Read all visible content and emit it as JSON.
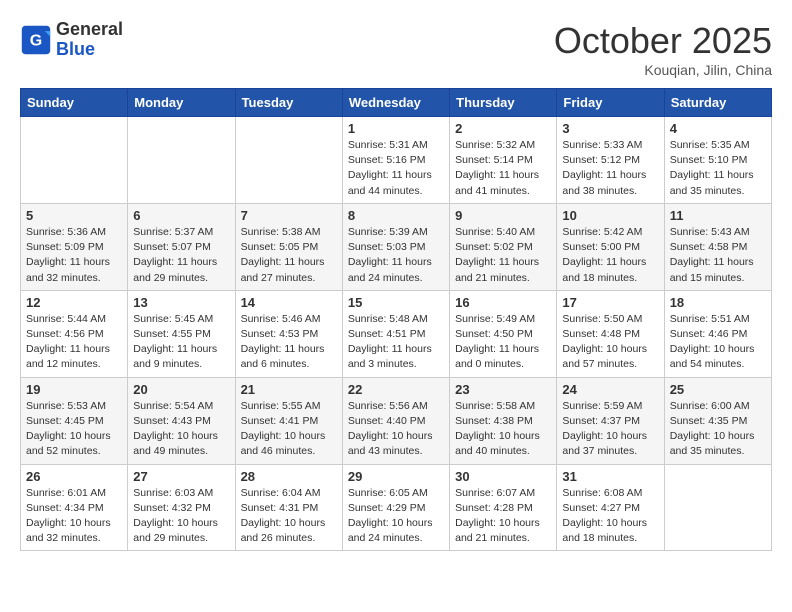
{
  "header": {
    "logo_general": "General",
    "logo_blue": "Blue",
    "month": "October 2025",
    "location": "Kouqian, Jilin, China"
  },
  "weekdays": [
    "Sunday",
    "Monday",
    "Tuesday",
    "Wednesday",
    "Thursday",
    "Friday",
    "Saturday"
  ],
  "weeks": [
    [
      {
        "day": "",
        "info": ""
      },
      {
        "day": "",
        "info": ""
      },
      {
        "day": "",
        "info": ""
      },
      {
        "day": "1",
        "info": "Sunrise: 5:31 AM\nSunset: 5:16 PM\nDaylight: 11 hours\nand 44 minutes."
      },
      {
        "day": "2",
        "info": "Sunrise: 5:32 AM\nSunset: 5:14 PM\nDaylight: 11 hours\nand 41 minutes."
      },
      {
        "day": "3",
        "info": "Sunrise: 5:33 AM\nSunset: 5:12 PM\nDaylight: 11 hours\nand 38 minutes."
      },
      {
        "day": "4",
        "info": "Sunrise: 5:35 AM\nSunset: 5:10 PM\nDaylight: 11 hours\nand 35 minutes."
      }
    ],
    [
      {
        "day": "5",
        "info": "Sunrise: 5:36 AM\nSunset: 5:09 PM\nDaylight: 11 hours\nand 32 minutes."
      },
      {
        "day": "6",
        "info": "Sunrise: 5:37 AM\nSunset: 5:07 PM\nDaylight: 11 hours\nand 29 minutes."
      },
      {
        "day": "7",
        "info": "Sunrise: 5:38 AM\nSunset: 5:05 PM\nDaylight: 11 hours\nand 27 minutes."
      },
      {
        "day": "8",
        "info": "Sunrise: 5:39 AM\nSunset: 5:03 PM\nDaylight: 11 hours\nand 24 minutes."
      },
      {
        "day": "9",
        "info": "Sunrise: 5:40 AM\nSunset: 5:02 PM\nDaylight: 11 hours\nand 21 minutes."
      },
      {
        "day": "10",
        "info": "Sunrise: 5:42 AM\nSunset: 5:00 PM\nDaylight: 11 hours\nand 18 minutes."
      },
      {
        "day": "11",
        "info": "Sunrise: 5:43 AM\nSunset: 4:58 PM\nDaylight: 11 hours\nand 15 minutes."
      }
    ],
    [
      {
        "day": "12",
        "info": "Sunrise: 5:44 AM\nSunset: 4:56 PM\nDaylight: 11 hours\nand 12 minutes."
      },
      {
        "day": "13",
        "info": "Sunrise: 5:45 AM\nSunset: 4:55 PM\nDaylight: 11 hours\nand 9 minutes."
      },
      {
        "day": "14",
        "info": "Sunrise: 5:46 AM\nSunset: 4:53 PM\nDaylight: 11 hours\nand 6 minutes."
      },
      {
        "day": "15",
        "info": "Sunrise: 5:48 AM\nSunset: 4:51 PM\nDaylight: 11 hours\nand 3 minutes."
      },
      {
        "day": "16",
        "info": "Sunrise: 5:49 AM\nSunset: 4:50 PM\nDaylight: 11 hours\nand 0 minutes."
      },
      {
        "day": "17",
        "info": "Sunrise: 5:50 AM\nSunset: 4:48 PM\nDaylight: 10 hours\nand 57 minutes."
      },
      {
        "day": "18",
        "info": "Sunrise: 5:51 AM\nSunset: 4:46 PM\nDaylight: 10 hours\nand 54 minutes."
      }
    ],
    [
      {
        "day": "19",
        "info": "Sunrise: 5:53 AM\nSunset: 4:45 PM\nDaylight: 10 hours\nand 52 minutes."
      },
      {
        "day": "20",
        "info": "Sunrise: 5:54 AM\nSunset: 4:43 PM\nDaylight: 10 hours\nand 49 minutes."
      },
      {
        "day": "21",
        "info": "Sunrise: 5:55 AM\nSunset: 4:41 PM\nDaylight: 10 hours\nand 46 minutes."
      },
      {
        "day": "22",
        "info": "Sunrise: 5:56 AM\nSunset: 4:40 PM\nDaylight: 10 hours\nand 43 minutes."
      },
      {
        "day": "23",
        "info": "Sunrise: 5:58 AM\nSunset: 4:38 PM\nDaylight: 10 hours\nand 40 minutes."
      },
      {
        "day": "24",
        "info": "Sunrise: 5:59 AM\nSunset: 4:37 PM\nDaylight: 10 hours\nand 37 minutes."
      },
      {
        "day": "25",
        "info": "Sunrise: 6:00 AM\nSunset: 4:35 PM\nDaylight: 10 hours\nand 35 minutes."
      }
    ],
    [
      {
        "day": "26",
        "info": "Sunrise: 6:01 AM\nSunset: 4:34 PM\nDaylight: 10 hours\nand 32 minutes."
      },
      {
        "day": "27",
        "info": "Sunrise: 6:03 AM\nSunset: 4:32 PM\nDaylight: 10 hours\nand 29 minutes."
      },
      {
        "day": "28",
        "info": "Sunrise: 6:04 AM\nSunset: 4:31 PM\nDaylight: 10 hours\nand 26 minutes."
      },
      {
        "day": "29",
        "info": "Sunrise: 6:05 AM\nSunset: 4:29 PM\nDaylight: 10 hours\nand 24 minutes."
      },
      {
        "day": "30",
        "info": "Sunrise: 6:07 AM\nSunset: 4:28 PM\nDaylight: 10 hours\nand 21 minutes."
      },
      {
        "day": "31",
        "info": "Sunrise: 6:08 AM\nSunset: 4:27 PM\nDaylight: 10 hours\nand 18 minutes."
      },
      {
        "day": "",
        "info": ""
      }
    ]
  ]
}
